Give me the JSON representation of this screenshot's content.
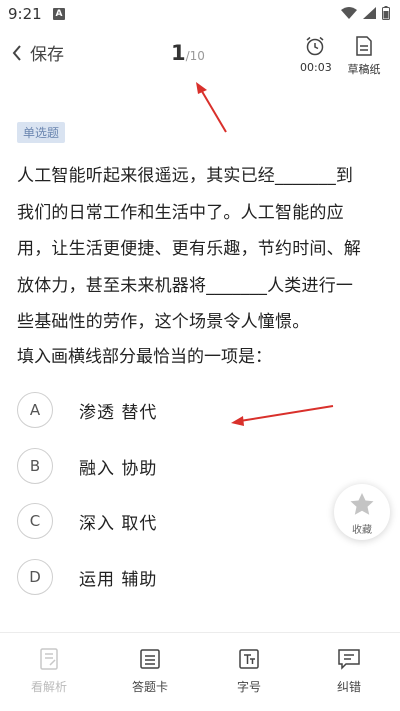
{
  "status_bar": {
    "time": "9:21",
    "notif_icon": "A"
  },
  "header": {
    "back_label": "保存",
    "progress_current": "1",
    "progress_total": "/10",
    "timer_value": "00:03",
    "draft_label": "草稿纸"
  },
  "question": {
    "type_tag": "单选题",
    "stem_lines": [
      "人工智能听起来很遥远，其实已经_______到",
      "我们的日常工作和生活中了。人工智能的应",
      "用，让生活更便捷、更有乐趣，节约时间、解",
      "放体力，甚至未来机器将_______人类进行一",
      "些基础性的劳作，这个场景令人憧憬。"
    ],
    "prompt": "填入画横线部分最恰当的一项是："
  },
  "options": [
    {
      "letter": "A",
      "text": "渗透 替代"
    },
    {
      "letter": "B",
      "text": "融入 协助"
    },
    {
      "letter": "C",
      "text": "深入 取代"
    },
    {
      "letter": "D",
      "text": "运用 辅助"
    }
  ],
  "favorite_label": "收藏",
  "bottom_nav": [
    {
      "label": "看解析",
      "icon": "analysis-icon"
    },
    {
      "label": "答题卡",
      "icon": "answer-sheet-icon"
    },
    {
      "label": "字号",
      "icon": "font-size-icon"
    },
    {
      "label": "纠错",
      "icon": "report-error-icon"
    }
  ],
  "colors": {
    "tag_bg": "#d9e3f1",
    "tag_text": "#6b86b0",
    "annotation_arrow": "#d9302b"
  }
}
